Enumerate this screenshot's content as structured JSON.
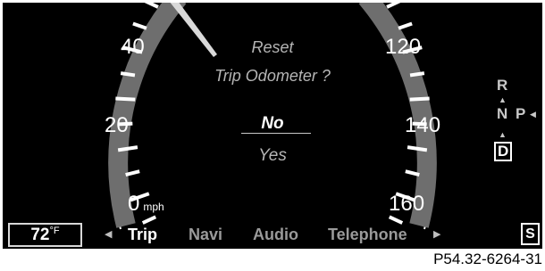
{
  "speedometer": {
    "scale_labels": [
      "40",
      "20",
      "0"
    ],
    "unit": "mph",
    "scale_labels_right": [
      "120",
      "140",
      "160"
    ]
  },
  "dialog": {
    "title_line1": "Reset",
    "title_line2": "Trip Odometer ?",
    "option_no": "No",
    "option_yes": "Yes",
    "selected": "No"
  },
  "gear": {
    "r": "R",
    "n": "N",
    "p": "P",
    "d": "D",
    "selected": "D"
  },
  "bottom": {
    "temperature": "72",
    "temperature_unit": "°F",
    "tabs": [
      "Trip",
      "Navi",
      "Audio",
      "Telephone"
    ],
    "active_tab": "Trip",
    "s_indicator": "S"
  },
  "caption": "P54.32-6264-31",
  "colors": {
    "background": "#000000",
    "arc": "#6e6e6e",
    "text": "#ffffff",
    "dim_text": "#b5b5b5"
  }
}
